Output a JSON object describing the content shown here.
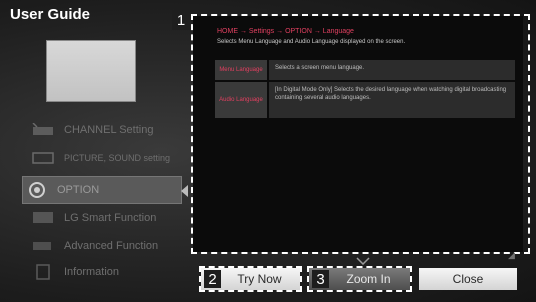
{
  "app": {
    "title": "User Guide"
  },
  "sidebar": {
    "items": [
      {
        "label": "CHANNEL Setting",
        "icon": "antenna-icon"
      },
      {
        "label": "PICTURE, SOUND setting",
        "icon": "picture-sound-icon"
      },
      {
        "label": "OPTION",
        "icon": "gear-icon",
        "selected": true
      },
      {
        "label": "LG Smart Function",
        "icon": "smart-tv-icon"
      },
      {
        "label": "Advanced Function",
        "icon": "advanced-icon"
      },
      {
        "label": "Information",
        "icon": "info-icon"
      }
    ]
  },
  "callouts": {
    "content": "1",
    "try_now": "2",
    "zoom_in": "3"
  },
  "content": {
    "breadcrumb": "HOME → Settings → OPTION → Language",
    "subtitle": "Selects Menu Language and Audio Language displayed on the screen.",
    "table": [
      {
        "key": "Menu Language",
        "value": "Selects a screen menu language."
      },
      {
        "key": "Audio Language",
        "value": "[In Digital Mode Only] Selects the desired language when watching digital broadcasting containing several audio languages."
      }
    ]
  },
  "buttons": {
    "try_now": "Try Now",
    "zoom_in": "Zoom In",
    "close": "Close"
  },
  "colors": {
    "accent": "#e04060",
    "focus": "#ffffff"
  }
}
